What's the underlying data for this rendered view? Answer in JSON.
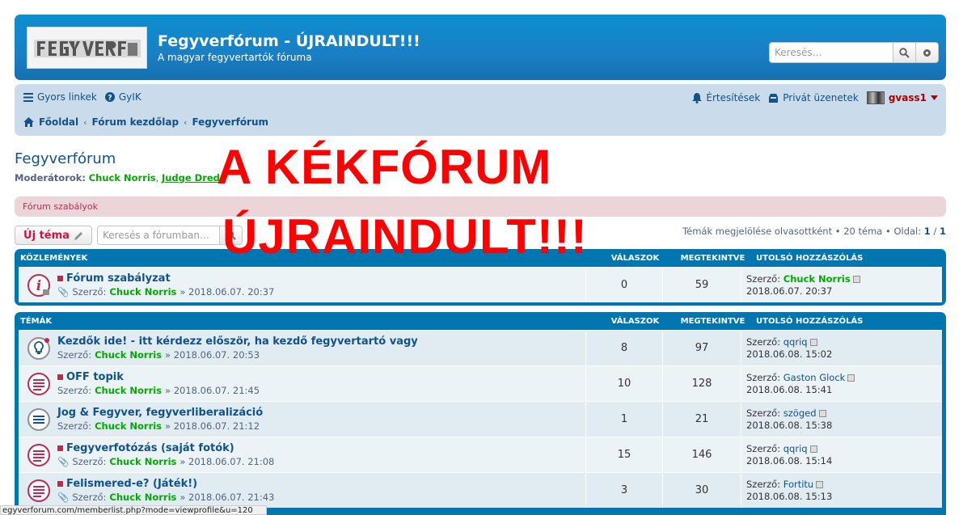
{
  "header": {
    "site_title": "Fegyverfórum - ÚJRAINDULT!!!",
    "site_description": "A magyar fegyvertartók fóruma",
    "search_placeholder": "Keresés…",
    "colors": {
      "header_bg": "#1a7fc4",
      "nav_bg": "#cadceb"
    }
  },
  "nav": {
    "quick_links": "Gyors linkek",
    "faq": "GyIK",
    "notifications": "Értesítések",
    "private_messages": "Privát üzenetek",
    "username": "gvass1",
    "breadcrumbs": [
      "Főoldal",
      "Fórum kezdőlap",
      "Fegyverfórum"
    ]
  },
  "forum": {
    "title": "Fegyverfórum",
    "moderators_label": "Moderátorok:",
    "moderators": [
      "Chuck Norris",
      "Judge Dred"
    ],
    "rules_label": "Fórum szabályok",
    "new_topic": "Új téma",
    "search_placeholder": "Keresés a fórumban…",
    "pagination": {
      "mark_read": "Témák megjelölése olvasottként",
      "topics": "20 téma",
      "page_label": "Oldal:",
      "current": "1",
      "separator": "/",
      "total": "1"
    }
  },
  "overlay": {
    "line1": "A KÉKFÓRUM",
    "line2": "ÚJRAINDULT!!!"
  },
  "columns": {
    "replies": "VÁLASZOK",
    "views": "MEGTEKINTVE",
    "last_post": "UTOLSÓ HOZZÁSZÓLÁS"
  },
  "announcements": {
    "header": "KÖZLEMÉNYEK",
    "rows": [
      {
        "title": "Fórum szabályzat",
        "by": "Szerző:",
        "author": "Chuck Norris",
        "date": "» 2018.06.07. 20:37",
        "replies": "0",
        "views": "59",
        "lp_by": "Szerző:",
        "lp_author": "Chuck Norris",
        "lp_date": "2018.06.07. 20:37"
      }
    ]
  },
  "topics": {
    "header": "TÉMÁK",
    "rows": [
      {
        "title": "Kezdők ide! - itt kérdezz először, ha kezdő fegyvertartó vagy",
        "by": "Szerző:",
        "author": "Chuck Norris",
        "date": "» 2018.06.07. 20:53",
        "replies": "8",
        "views": "97",
        "lp_by": "Szerző:",
        "lp_author": "qqriq",
        "lp_date": "2018.06.08. 15:02"
      },
      {
        "title": "OFF topik",
        "by": "Szerző:",
        "author": "Chuck Norris",
        "date": "» 2018.06.07. 21:45",
        "replies": "10",
        "views": "128",
        "lp_by": "Szerző:",
        "lp_author": "Gaston Glock",
        "lp_date": "2018.06.08. 15:41"
      },
      {
        "title": "Jog & Fegyver, fegyverliberalizáció",
        "by": "Szerző:",
        "author": "Chuck Norris",
        "date": "» 2018.06.07. 21:12",
        "replies": "1",
        "views": "21",
        "lp_by": "Szerző:",
        "lp_author": "szöged",
        "lp_date": "2018.06.08. 15:38"
      },
      {
        "title": "Fegyverfotózás (saját fotók)",
        "by": "Szerző:",
        "author": "Chuck Norris",
        "date": "» 2018.06.07. 21:08",
        "replies": "15",
        "views": "146",
        "lp_by": "Szerző:",
        "lp_author": "qqriq",
        "lp_date": "2018.06.08. 15:14"
      },
      {
        "title": "Felismered-e? (Játék!)",
        "by": "Szerző:",
        "author": "Chuck Norris",
        "date": "» 2018.06.07. 21:43",
        "replies": "3",
        "views": "30",
        "lp_by": "Szerző:",
        "lp_author": "Fortitu",
        "lp_date": "2018.06.08. 15:13"
      }
    ]
  },
  "statusbar": {
    "url": "egyverforum.com/memberlist.php?mode=viewprofile&u=120"
  }
}
